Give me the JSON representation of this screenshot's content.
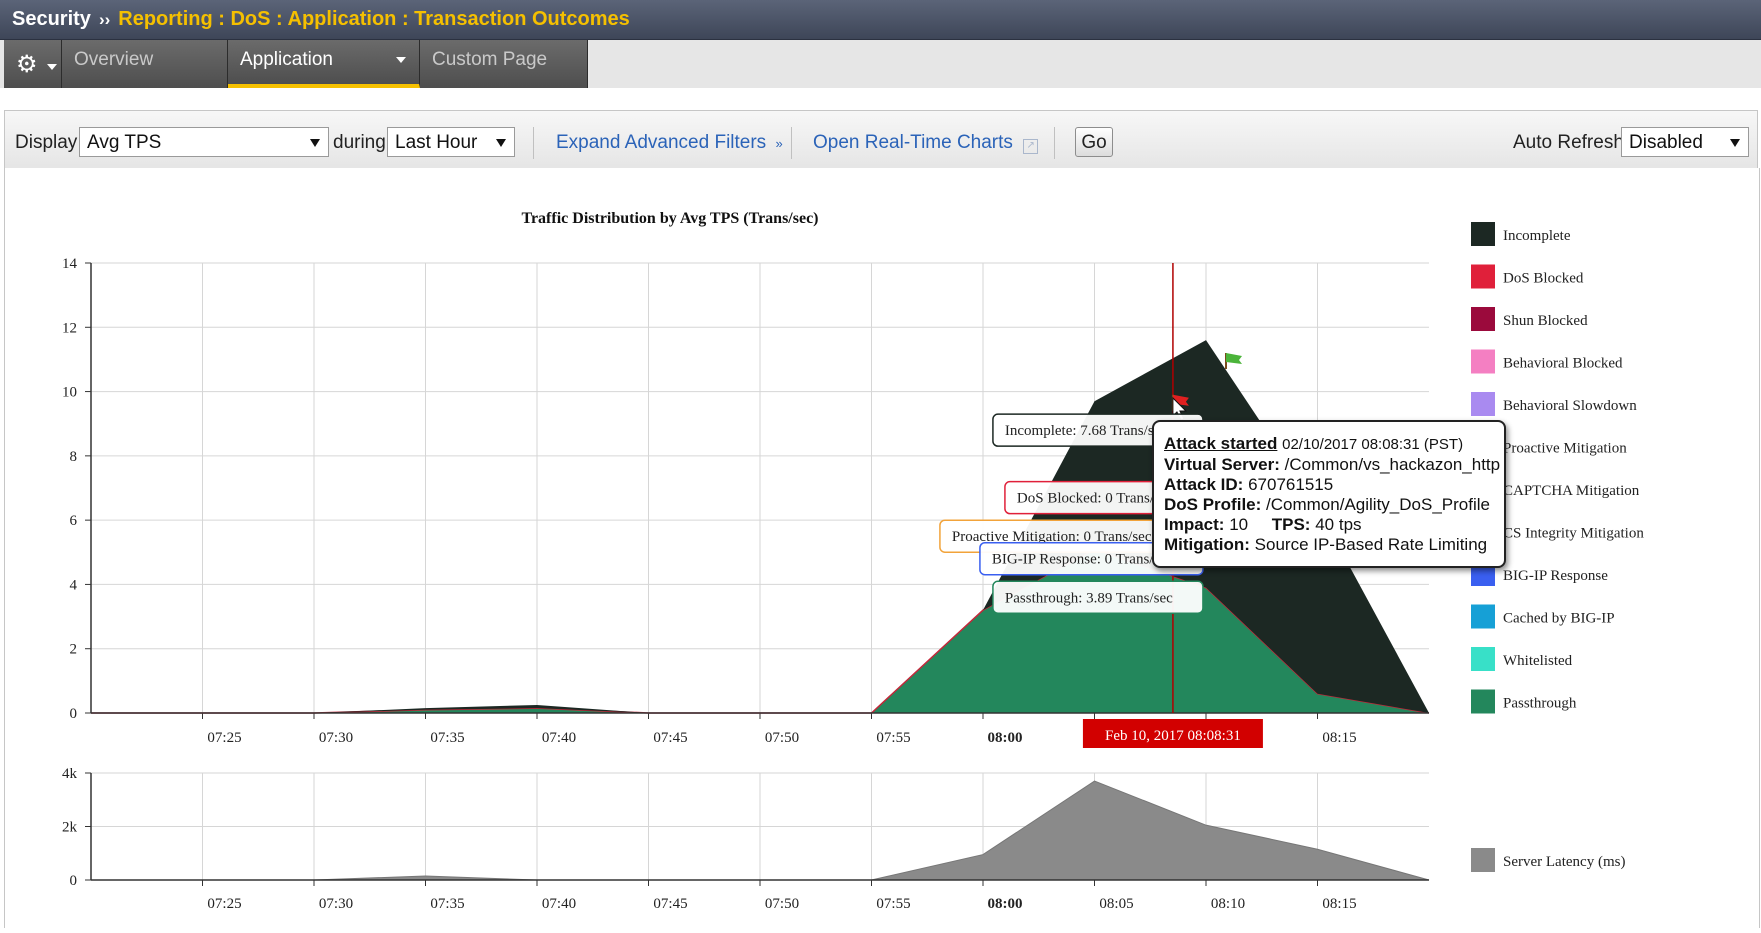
{
  "breadcrumb": {
    "root": "Security",
    "separator": "››",
    "path": "Reporting : DoS : Application : Transaction Outcomes"
  },
  "tabs": {
    "overview": "Overview",
    "application": "Application",
    "custom_page": "Custom Page"
  },
  "toolbar": {
    "display_label": "Display",
    "display_value": "Avg TPS",
    "during_label": "during",
    "during_value": "Last Hour",
    "expand_filters": "Expand Advanced Filters",
    "real_time": "Open Real-Time Charts",
    "go": "Go",
    "auto_refresh_label": "Auto Refresh",
    "auto_refresh_value": "Disabled"
  },
  "chart_data": [
    {
      "type": "area",
      "title": "Traffic Distribution by Avg TPS (Trans/sec)",
      "x_ticks": [
        "07:25",
        "07:30",
        "07:35",
        "07:40",
        "07:45",
        "07:50",
        "07:55",
        "08:00",
        "08:15"
      ],
      "x": [
        "07:20",
        "07:25",
        "07:30",
        "07:35",
        "07:40",
        "07:45",
        "07:50",
        "07:55",
        "08:00",
        "08:05",
        "08:10",
        "08:15",
        "08:20"
      ],
      "ylim": [
        0,
        14
      ],
      "y_ticks": [
        0,
        2,
        4,
        6,
        8,
        10,
        12,
        14
      ],
      "grid": true,
      "legend_position": "right",
      "series": [
        {
          "name": "Passthrough",
          "color": "#23875c",
          "values": [
            0,
            0,
            0,
            0.1,
            0.15,
            0,
            0,
            0,
            3.2,
            5.1,
            3.9,
            0.6,
            0
          ]
        },
        {
          "name": "Incomplete",
          "color": "#1c2823",
          "values": [
            0,
            0,
            0,
            0.05,
            0.1,
            0,
            0,
            0,
            0,
            4.6,
            7.7,
            5.8,
            0
          ]
        }
      ],
      "legend": [
        {
          "name": "Incomplete",
          "color": "#1c2823"
        },
        {
          "name": "DoS Blocked",
          "color": "#e0203a"
        },
        {
          "name": "Shun Blocked",
          "color": "#9b0a3c"
        },
        {
          "name": "Behavioral Blocked",
          "color": "#f47fc2"
        },
        {
          "name": "Behavioral Slowdown",
          "color": "#a98af0"
        },
        {
          "name": "Proactive Mitigation",
          "color": "#f2a33a"
        },
        {
          "name": "CAPTCHA Mitigation",
          "color": "#d6c24a"
        },
        {
          "name": "CS Integrity Mitigation",
          "color": "#7fb0d8"
        },
        {
          "name": "BIG-IP Response",
          "color": "#3a5ff0"
        },
        {
          "name": "Cached by BIG-IP",
          "color": "#16a0d6"
        },
        {
          "name": "Whitelisted",
          "color": "#38e0c8"
        },
        {
          "name": "Passthrough",
          "color": "#23875c"
        }
      ],
      "hover_labels": [
        {
          "text": "Incomplete: 7.68 Trans/sec",
          "color": "#1c2823"
        },
        {
          "text": "DoS Blocked: 0 Trans/sec",
          "color": "#e0203a"
        },
        {
          "text": "Proactive Mitigation: 0 Trans/sec",
          "color": "#f2a33a"
        },
        {
          "text": "BIG-IP Response: 0 Trans/sec",
          "color": "#3a5ff0"
        },
        {
          "text": "Passthrough: 3.89 Trans/sec",
          "color": "#23875c"
        }
      ],
      "crosshair_label": "Feb 10, 2017 08:08:31",
      "crosshair_time": "08:08:31"
    },
    {
      "type": "area",
      "x_ticks": [
        "07:25",
        "07:30",
        "07:35",
        "07:40",
        "07:45",
        "07:50",
        "07:55",
        "08:00",
        "08:05",
        "08:10",
        "08:15"
      ],
      "x": [
        "07:20",
        "07:25",
        "07:30",
        "07:35",
        "07:40",
        "07:45",
        "07:50",
        "07:55",
        "08:00",
        "08:05",
        "08:10",
        "08:15",
        "08:20"
      ],
      "y_ticks": [
        "0",
        "2k",
        "4k"
      ],
      "ylim": [
        0,
        4000
      ],
      "grid": true,
      "series": [
        {
          "name": "Server Latency (ms)",
          "color": "#8a8a8a",
          "values": [
            0,
            0,
            0,
            150,
            0,
            0,
            0,
            0,
            950,
            3700,
            2050,
            1150,
            0
          ]
        }
      ]
    }
  ],
  "tooltip": {
    "title": "Attack started",
    "timestamp": "02/10/2017 08:08:31 (PST)",
    "virtual_server_label": "Virtual Server:",
    "virtual_server": "/Common/vs_hackazon_http",
    "attack_id_label": "Attack ID:",
    "attack_id": "670761515",
    "dos_profile_label": "DoS Profile:",
    "dos_profile": "/Common/Agility_DoS_Profile",
    "impact_label": "Impact:",
    "impact": "10",
    "tps_label": "TPS:",
    "tps": "40 tps",
    "mitigation_label": "Mitigation:",
    "mitigation": "Source IP-Based Rate Limiting"
  }
}
